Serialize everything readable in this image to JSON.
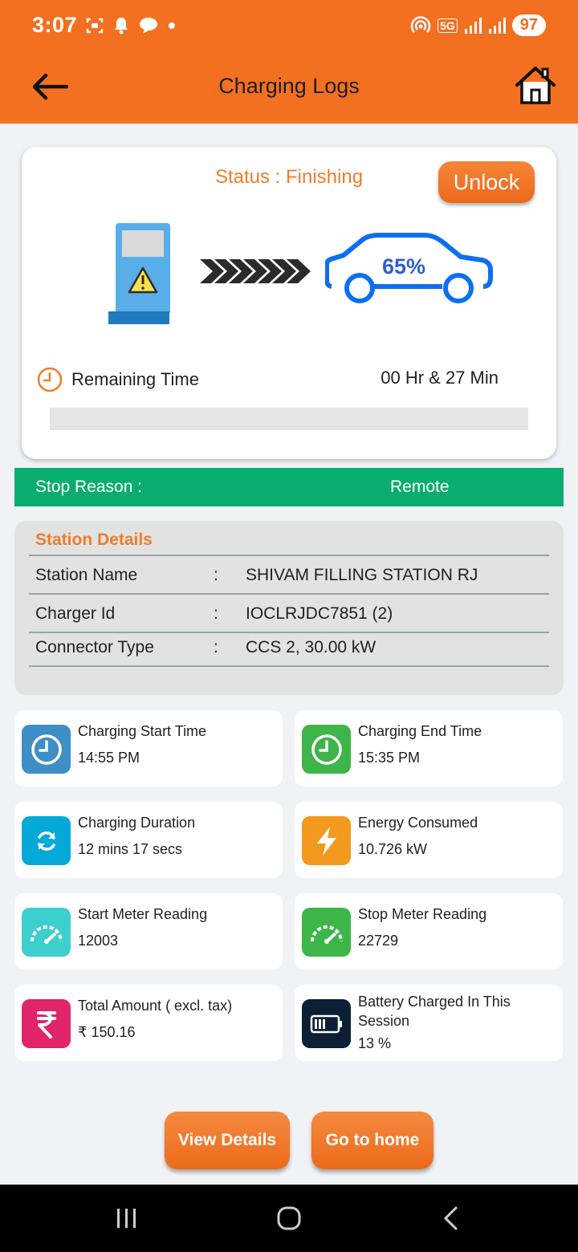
{
  "status_bar": {
    "time": "3:07",
    "battery": "97",
    "network": "5G"
  },
  "header": {
    "title": "Charging Logs"
  },
  "status_card": {
    "status_text": "Status : Finishing",
    "unlock_label": "Unlock",
    "battery_percent_label": "65%",
    "remaining_time_label": "Remaining Time",
    "remaining_time_value": "00 Hr & 27 Min",
    "progress_fraction": 0
  },
  "stop_reason": {
    "label": "Stop Reason :",
    "value": "Remote"
  },
  "station_details": {
    "title": "Station Details",
    "rows": [
      {
        "label": "Station Name",
        "colon": ":",
        "value": "SHIVAM FILLING STATION RJ"
      },
      {
        "label": "Charger Id",
        "colon": ":",
        "value": "IOCLRJDC7851 (2)"
      },
      {
        "label": "Connector Type",
        "colon": ":",
        "value": "CCS 2, 30.00 kW"
      }
    ]
  },
  "tiles": [
    {
      "label": "Charging Start Time",
      "value": "14:55 PM",
      "icon": "clock-icon",
      "color": "#3d8fc6"
    },
    {
      "label": "Charging End Time",
      "value": "15:35 PM",
      "icon": "clock-icon",
      "color": "#3db548"
    },
    {
      "label": "Charging Duration",
      "value": "12 mins 17 secs",
      "icon": "refresh-icon",
      "color": "#05a9d8"
    },
    {
      "label": "Energy Consumed",
      "value": "10.726 kW",
      "icon": "lightning-icon",
      "color": "#f39a1e"
    },
    {
      "label": "Start Meter Reading",
      "value": "12003",
      "icon": "speedometer-icon",
      "color": "#3dcfce"
    },
    {
      "label": "Stop Meter Reading",
      "value": "22729",
      "icon": "speedometer-icon",
      "color": "#3db548"
    },
    {
      "label": "Total Amount ( excl. tax)",
      "value": "₹ 150.16",
      "icon": "rupee-icon",
      "color": "#e0256b"
    },
    {
      "label": "Battery Charged In This Session",
      "value": "13 %",
      "icon": "battery-icon",
      "color": "#0b1f35"
    }
  ],
  "buttons": {
    "view_details": "View Details",
    "go_home": "Go to home"
  },
  "colors": {
    "brand": "#f37021",
    "stop_bar": "#09ad6f",
    "accent_text": "#f07d2a"
  }
}
